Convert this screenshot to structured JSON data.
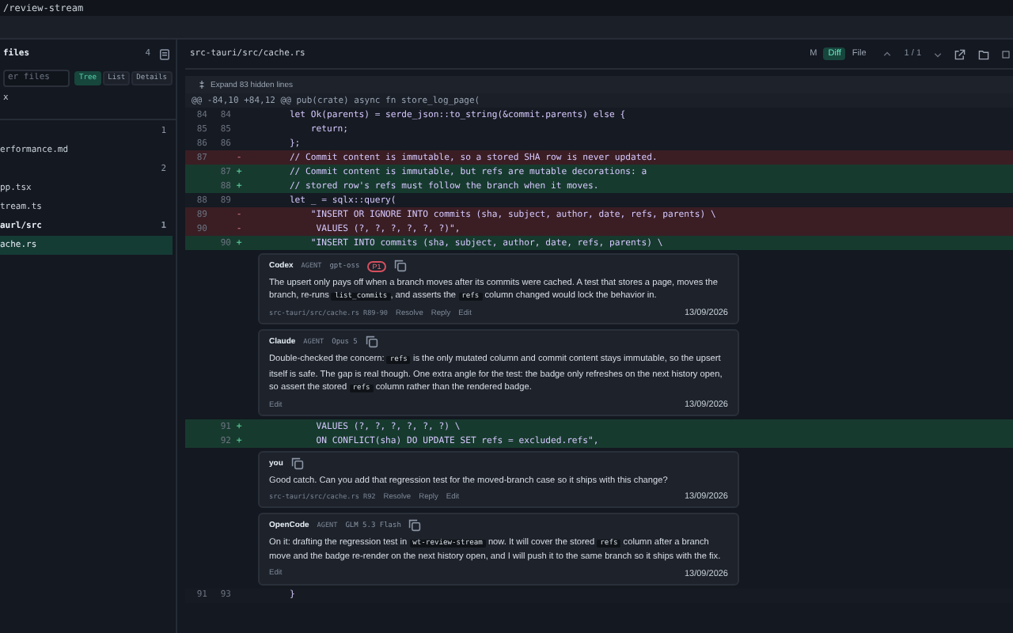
{
  "window": {
    "title": "/review-stream"
  },
  "sidebar": {
    "title": "files",
    "count": "4",
    "filter": {
      "placeholder": "er files"
    },
    "views": [
      {
        "label": "Tree",
        "selected": true
      },
      {
        "label": "List",
        "selected": false
      },
      {
        "label": "Details",
        "selected": false
      }
    ],
    "scope": "x",
    "items": [
      {
        "count": "1",
        "bold": false,
        "selected": false
      },
      {
        "name": "erformance.md",
        "bold": false,
        "selected": false
      },
      {
        "count": "2",
        "bold": false,
        "selected": false
      },
      {
        "name": "pp.tsx",
        "bold": false,
        "selected": false
      },
      {
        "name": "tream.ts",
        "bold": false,
        "selected": false
      },
      {
        "name": "aurl/src",
        "count": "1",
        "bold": true,
        "selected": false
      },
      {
        "name": "ache.rs",
        "bold": false,
        "selected": true
      }
    ]
  },
  "file": {
    "path": "src-tauri/src/cache.rs",
    "modes": [
      {
        "label": "M",
        "selected": false
      },
      {
        "label": "Diff",
        "selected": true
      },
      {
        "label": "File",
        "selected": false
      }
    ],
    "position": "1 / 1"
  },
  "diff": {
    "expand": "Expand 83 hidden lines",
    "hunk": "@@ -84,10 +84,12 @@ pub(crate) async fn store_log_page(",
    "blocks": [
      {
        "kind": "lines",
        "lines": [
          {
            "kind": "context",
            "old": "84",
            "new": "84",
            "code": "        let Ok(parents) = serde_json::to_string(&commit.parents) else {"
          },
          {
            "kind": "context",
            "old": "85",
            "new": "85",
            "code": "            return;"
          },
          {
            "kind": "context",
            "old": "86",
            "new": "86",
            "code": "        };"
          },
          {
            "kind": "removed",
            "old": "87",
            "sign": "-",
            "code": "        // Commit content is immutable, so a stored SHA row is never updated."
          },
          {
            "kind": "added",
            "new": "87",
            "sign": "+",
            "code": "        // Commit content is immutable, but refs are mutable decorations: a"
          },
          {
            "kind": "added",
            "new": "88",
            "sign": "+",
            "code": "        // stored row's refs must follow the branch when it moves."
          },
          {
            "kind": "context",
            "old": "88",
            "new": "89",
            "code": "        let _ = sqlx::query("
          },
          {
            "kind": "removed",
            "old": "89",
            "sign": "-",
            "code": "            \"INSERT OR IGNORE INTO commits (sha, subject, author, date, refs, parents) \\"
          },
          {
            "kind": "removed",
            "old": "90",
            "sign": "-",
            "code": "             VALUES (?, ?, ?, ?, ?, ?)\","
          },
          {
            "kind": "added",
            "new": "90",
            "sign": "+",
            "code": "            \"INSERT INTO commits (sha, subject, author, date, refs, parents) \\"
          }
        ]
      },
      {
        "kind": "comments",
        "comments": [
          {
            "author": "Codex",
            "tag": "AGENT",
            "model": "gpt-oss",
            "priority": "P1",
            "body": [
              {
                "kind": "text",
                "text": "The upsert only pays off when a branch moves after its commits were cached. A test that stores a page, moves the branch, re-runs "
              },
              {
                "kind": "code",
                "text": "list_commits"
              },
              {
                "kind": "text",
                "text": ", and asserts the "
              },
              {
                "kind": "code",
                "text": "refs"
              },
              {
                "kind": "text",
                "text": " column changed would lock the behavior in."
              }
            ],
            "location": "src-tauri/src/cache.rs R89-90",
            "actions": [
              "Resolve",
              "Reply",
              "Edit"
            ],
            "date": "13/09/2026"
          },
          {
            "author": "Claude",
            "tag": "AGENT",
            "model": "Opus 5",
            "body": [
              {
                "kind": "text",
                "text": "Double-checked the concern: "
              },
              {
                "kind": "code",
                "text": "refs"
              },
              {
                "kind": "text",
                "text": " is the only mutated column and commit content stays immutable, so the upsert itself is safe. The gap is real though. One extra angle for the test: the badge only refreshes on the next history open, so assert the stored "
              },
              {
                "kind": "code",
                "text": "refs"
              },
              {
                "kind": "text",
                "text": " column rather than the rendered badge."
              }
            ],
            "actions": [
              "Edit"
            ],
            "date": "13/09/2026"
          }
        ]
      },
      {
        "kind": "lines",
        "lines": [
          {
            "kind": "added",
            "new": "91",
            "sign": "+",
            "code": "             VALUES (?, ?, ?, ?, ?, ?) \\"
          },
          {
            "kind": "added",
            "new": "92",
            "sign": "+",
            "code": "             ON CONFLICT(sha) DO UPDATE SET refs = excluded.refs\","
          }
        ]
      },
      {
        "kind": "comments",
        "comments": [
          {
            "author": "you",
            "body": [
              {
                "kind": "text",
                "text": "Good catch. Can you add that regression test for the moved-branch case so it ships with this change?"
              }
            ],
            "location": "src-tauri/src/cache.rs R92",
            "actions": [
              "Resolve",
              "Reply",
              "Edit"
            ],
            "date": "13/09/2026"
          },
          {
            "author": "OpenCode",
            "tag": "AGENT",
            "model": "GLM 5.3 Flash",
            "body": [
              {
                "kind": "text",
                "text": "On it: drafting the regression test in "
              },
              {
                "kind": "code",
                "text": "wt-review-stream"
              },
              {
                "kind": "text",
                "text": " now. It will cover the stored "
              },
              {
                "kind": "code",
                "text": "refs"
              },
              {
                "kind": "text",
                "text": " column after a branch move and the badge re-render on the next history open, and I will push it to the same branch so it ships with the fix."
              }
            ],
            "actions": [
              "Edit"
            ],
            "date": "13/09/2026"
          }
        ]
      },
      {
        "kind": "lines",
        "lines": [
          {
            "kind": "context",
            "old": "91",
            "new": "93",
            "code": "        }"
          }
        ]
      }
    ]
  }
}
